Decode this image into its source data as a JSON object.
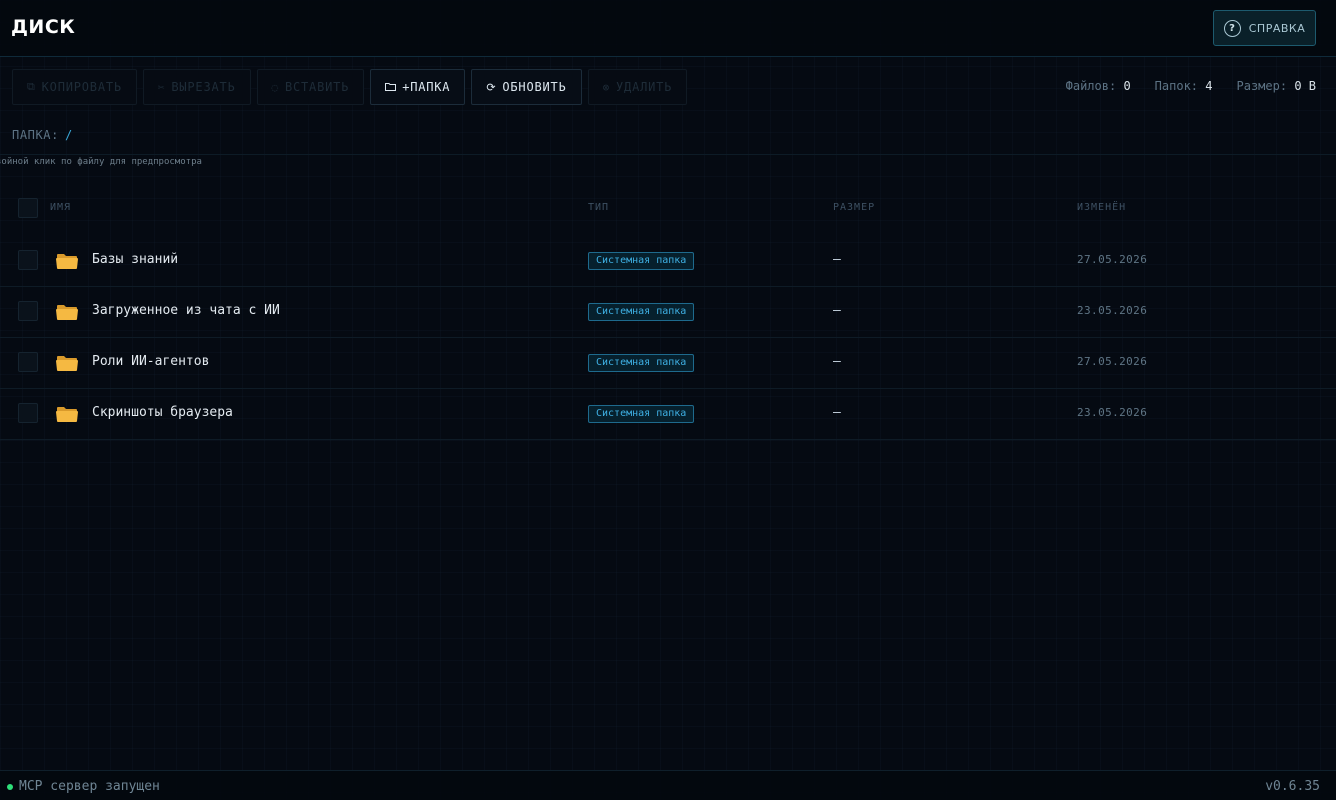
{
  "header": {
    "title": "ДИСК",
    "help_label": "СПРАВКА",
    "help_icon": "?"
  },
  "toolbar": {
    "copy_label": "КОПИРОВАТЬ",
    "cut_label": "ВЫРЕЗАТЬ",
    "paste_label": "ВСТАВИТЬ",
    "new_folder_label": "+ПАПКА",
    "refresh_label": "ОБНОВИТЬ",
    "delete_label": "УДАЛИТЬ"
  },
  "stats": {
    "files_label": "Файлов:",
    "files_value": "0",
    "folders_label": "Папок:",
    "folders_value": "4",
    "size_label": "Размер:",
    "size_value": "0 B"
  },
  "path": {
    "label": "ПАПКА:",
    "value": "/"
  },
  "hint": "войной клик по файлу для предпросмотра",
  "table": {
    "columns": [
      "ИМЯ",
      "ТИП",
      "РАЗМЕР",
      "ИЗМЕНЁН"
    ],
    "rows": [
      {
        "name": "Базы знаний",
        "type": "Системная папка",
        "size": "—",
        "modified": "27.05.2026"
      },
      {
        "name": "Загруженное из чата с ИИ",
        "type": "Системная папка",
        "size": "—",
        "modified": "23.05.2026"
      },
      {
        "name": "Роли ИИ-агентов",
        "type": "Системная папка",
        "size": "—",
        "modified": "27.05.2026"
      },
      {
        "name": "Скриншоты браузера",
        "type": "Системная папка",
        "size": "—",
        "modified": "23.05.2026"
      }
    ]
  },
  "footer": {
    "status": "MCP сервер запущен",
    "version": "v0.6.35"
  },
  "colors": {
    "accent": "#3fb0e4",
    "folder": "#f5b942",
    "status_ok": "#2ee07a"
  }
}
